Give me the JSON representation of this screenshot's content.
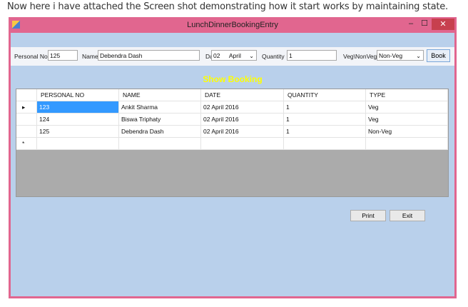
{
  "caption": "Now here i have attached the Screen shot demonstrating how it start works by maintaining state.",
  "window": {
    "title": "LunchDinnerBookingEntry",
    "min": "–",
    "max": "☐",
    "close": "✕"
  },
  "form": {
    "personal_no_label": "Personal No",
    "personal_no": "125",
    "name_label": "Name",
    "name": "Debendra Dash",
    "date_label": "Date",
    "date_day": "02",
    "date_month": "April",
    "quantity_label": "Quantity",
    "quantity": "1",
    "type_label": "Veg\\NonVeg",
    "type": "Non-Veg",
    "book": "Book"
  },
  "heading": "Show Booking",
  "grid": {
    "columns": [
      "PERSONAL NO",
      "NAME",
      "DATE",
      "QUANTITY",
      "TYPE"
    ],
    "rows": [
      [
        "123",
        "Ankit Sharma",
        "02 April 2016",
        "1",
        "Veg"
      ],
      [
        "124",
        "Biswa Triphaty",
        "02 April 2016",
        "1",
        "Veg"
      ],
      [
        "125",
        "Debendra Dash",
        "02 April 2016",
        "1",
        "Non-Veg"
      ]
    ],
    "current_marker": "▸",
    "new_marker": "*"
  },
  "buttons": {
    "print": "Print",
    "exit": "Exit"
  }
}
